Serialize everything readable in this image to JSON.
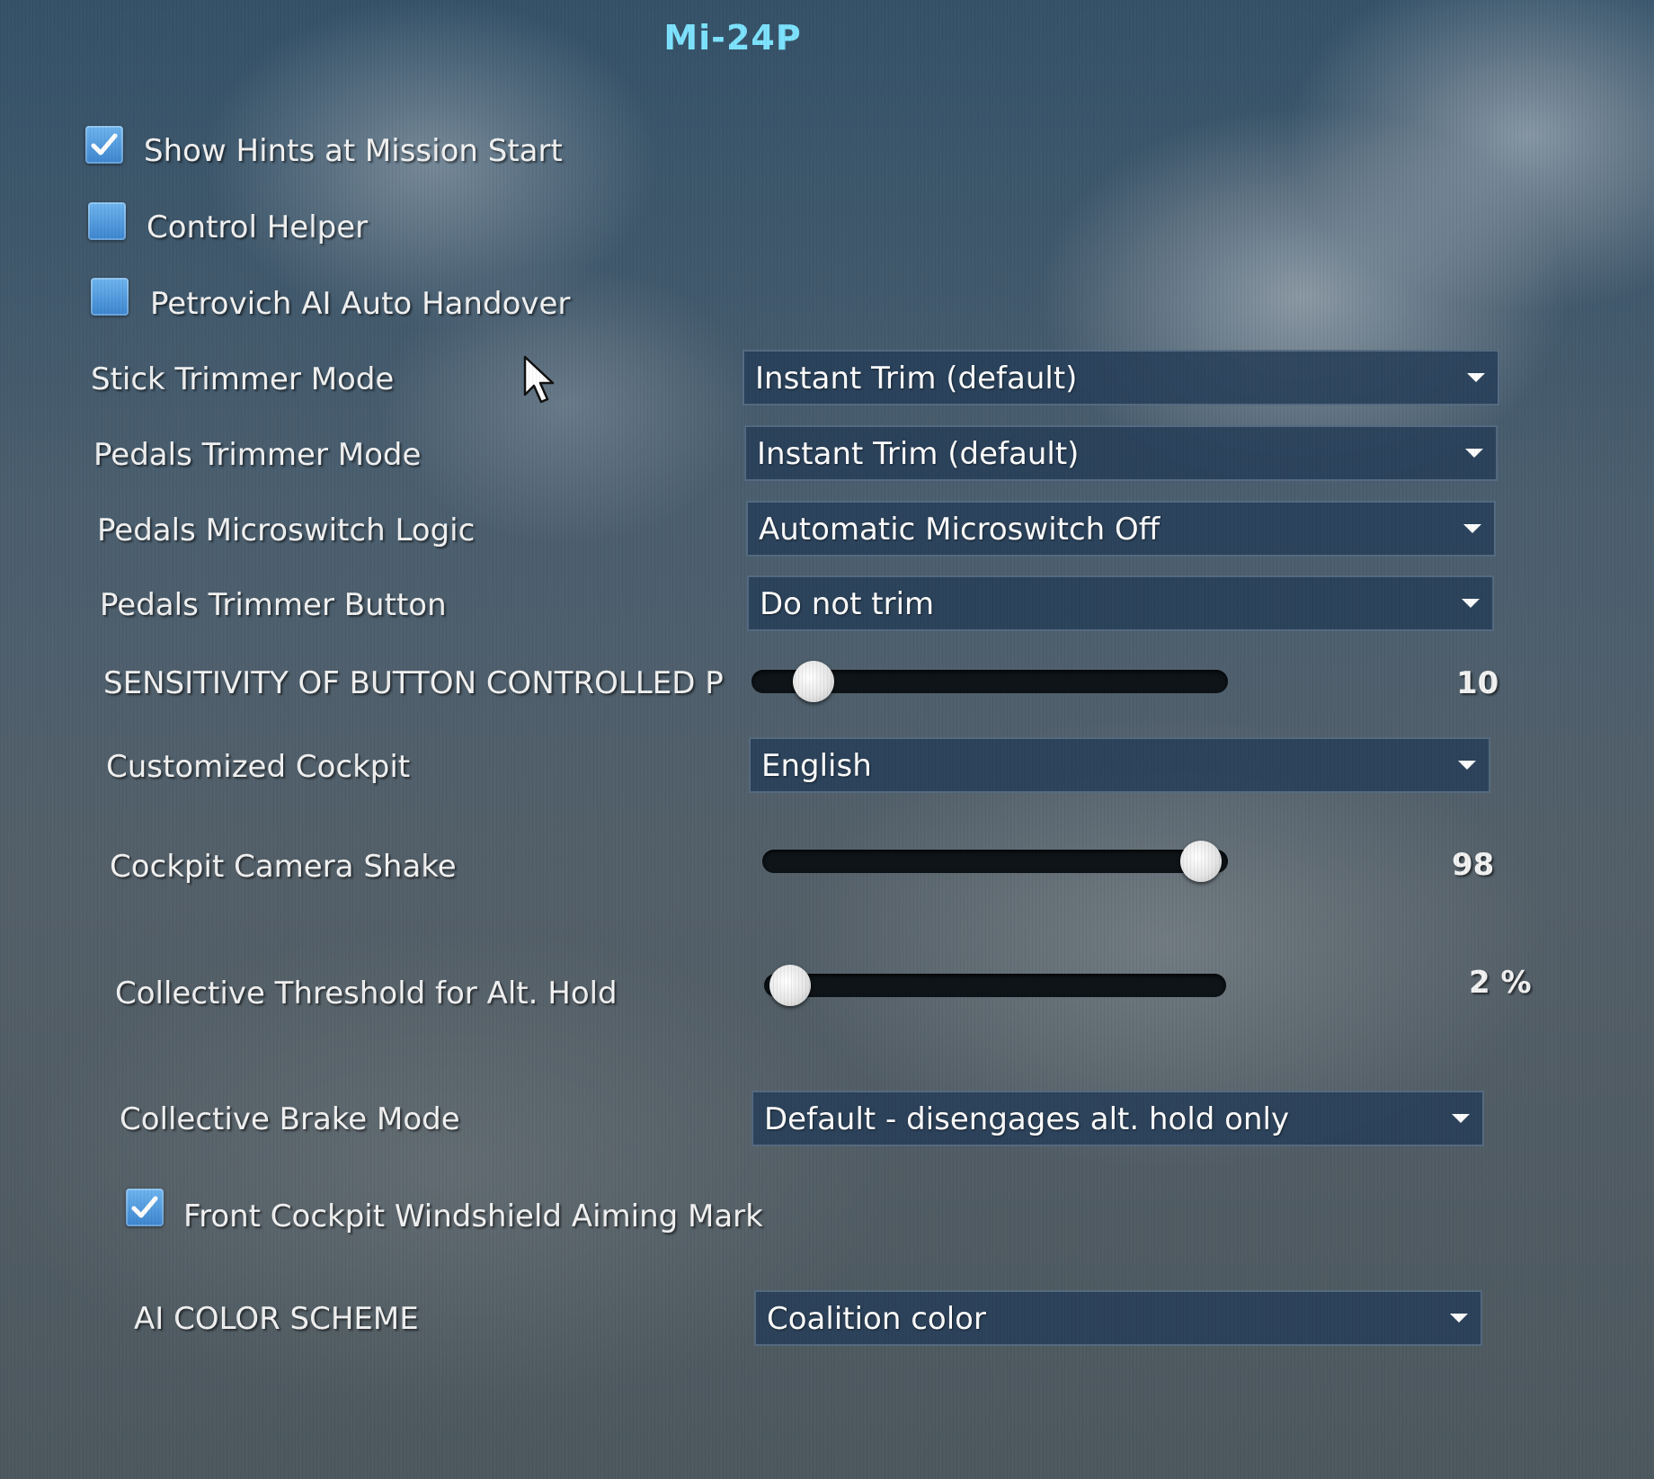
{
  "title": "Mi-24P",
  "checkboxes": [
    {
      "label": "Show Hints at Mission Start",
      "checked": true
    },
    {
      "label": "Control Helper",
      "checked": false
    },
    {
      "label": "Petrovich AI Auto Handover",
      "checked": false
    },
    {
      "label": "Front Cockpit Windshield Aiming Mark",
      "checked": true
    }
  ],
  "settings": {
    "stick_trimmer_mode": {
      "label": "Stick Trimmer Mode",
      "value": "Instant Trim (default)"
    },
    "pedals_trimmer_mode": {
      "label": "Pedals Trimmer Mode",
      "value": "Instant Trim (default)"
    },
    "pedals_microswitch_logic": {
      "label": "Pedals Microswitch Logic",
      "value": "Automatic Microswitch Off"
    },
    "pedals_trimmer_button": {
      "label": "Pedals Trimmer Button",
      "value": "Do not trim"
    },
    "sensitivity_button_pedals": {
      "label": "SENSITIVITY OF BUTTON CONTROLLED PEDALS",
      "value": 10,
      "display": "10",
      "min": 0,
      "max": 100
    },
    "customized_cockpit": {
      "label": "Customized Cockpit",
      "value": "English"
    },
    "cockpit_camera_shake": {
      "label": "Cockpit Camera Shake",
      "value": 98,
      "display": "98",
      "min": 0,
      "max": 100
    },
    "collective_threshold": {
      "label": "Collective Threshold for Alt. Hold",
      "value": 2,
      "display": "2 %",
      "min": 0,
      "max": 100
    },
    "collective_brake_mode": {
      "label": "Collective Brake Mode",
      "value": "Default - disengages alt. hold only"
    },
    "ai_color_scheme": {
      "label": "AI COLOR SCHEME",
      "value": "Coalition color"
    }
  },
  "icons": {
    "checkbox_check": "check-icon",
    "dropdown_arrow": "triangle-down-icon",
    "cursor": "mouse-pointer-icon"
  },
  "colors": {
    "title": "#7ee3ff",
    "checkbox": "#4a94dc",
    "dropdown_bg": "#28405a"
  }
}
